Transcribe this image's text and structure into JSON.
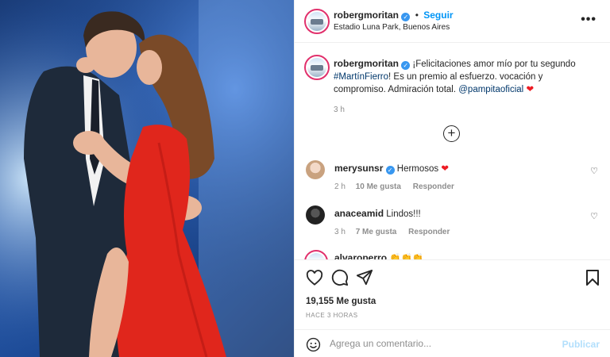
{
  "post": {
    "username": "robergmoritan",
    "follow_label": "Seguir",
    "location": "Estadio Luna Park, Buenos Aires",
    "more_label": "•••"
  },
  "caption": {
    "username": "robergmoritan",
    "text_before": "¡Felicitaciones amor mío por tu segundo",
    "hashtag": "#MartínFierro",
    "text_middle": "! Es un premio al esfuerzo. vocación y compromiso. Admiración total.",
    "mention": "@pampitaoficial",
    "heart": "❤",
    "time": "3 h"
  },
  "comments": [
    {
      "username": "merysunsr",
      "text": "Hermosos",
      "heart": "❤",
      "time": "2 h",
      "likes": "10 Me gusta",
      "reply": "Responder"
    },
    {
      "username": "anaceamid",
      "text": "Lindos!!!",
      "time": "3 h",
      "likes": "7 Me gusta",
      "reply": "Responder"
    },
    {
      "username": "alvaroperro",
      "text": "👏👏👏"
    }
  ],
  "actions": {
    "likes_count": "19,155 Me gusta",
    "posted_ago": "HACE 3 HORAS"
  },
  "add_comment": {
    "placeholder": "Agrega un comentario...",
    "publish_label": "Publicar"
  },
  "colors": {
    "accent": "#0095f6",
    "heart_red": "#ed1c24",
    "dress_red": "#e0261c",
    "muted": "#8e8e8e"
  }
}
